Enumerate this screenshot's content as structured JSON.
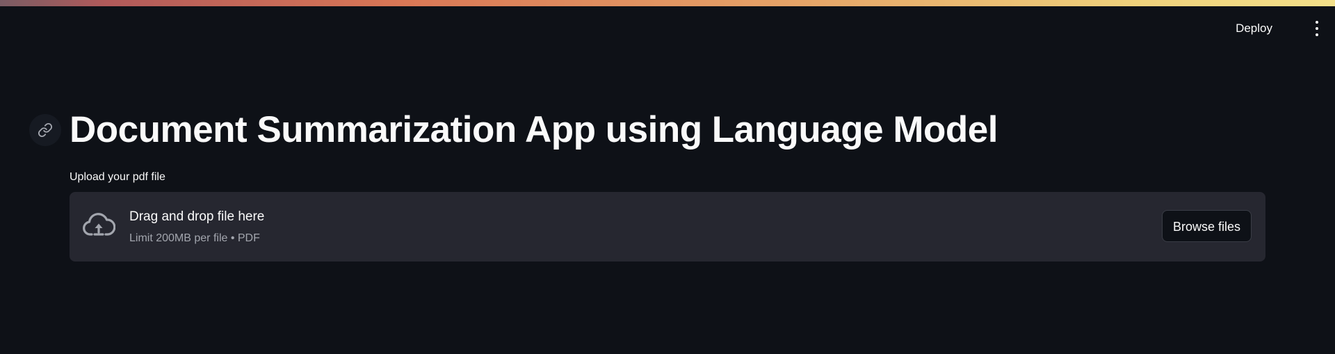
{
  "header": {
    "deploy_label": "Deploy",
    "menu_icon": "more-vertical-icon"
  },
  "main": {
    "anchor_icon": "link-icon",
    "title": "Document Summarization App using Language Model",
    "uploader": {
      "label": "Upload your pdf file",
      "icon": "cloud-upload-icon",
      "instruction": "Drag and drop file here",
      "limit_text": "Limit 200MB per file • PDF",
      "browse_label": "Browse files"
    }
  },
  "colors": {
    "background": "#0e1117",
    "dropzone": "#262730",
    "text": "#fafafa",
    "muted_text": "#a3a6ae",
    "accent_gradient_start": "#d97756",
    "accent_gradient_end": "#f3e08a"
  }
}
